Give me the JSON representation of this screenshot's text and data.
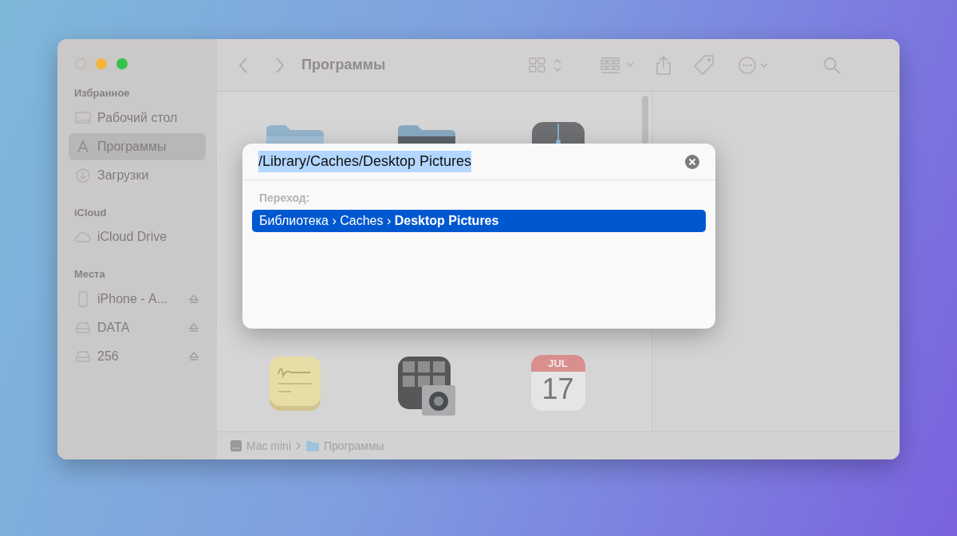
{
  "window": {
    "title": "Программы"
  },
  "sidebar": {
    "sections": [
      {
        "title": "Избранное",
        "items": [
          {
            "label": "Рабочий стол",
            "kind": "desktop",
            "selected": false,
            "ejectable": false
          },
          {
            "label": "Программы",
            "kind": "apps",
            "selected": true,
            "ejectable": false
          },
          {
            "label": "Загрузки",
            "kind": "downloads",
            "selected": false,
            "ejectable": false
          }
        ]
      },
      {
        "title": "iCloud",
        "items": [
          {
            "label": "iCloud Drive",
            "kind": "cloud",
            "selected": false,
            "ejectable": false
          }
        ]
      },
      {
        "title": "Места",
        "items": [
          {
            "label": "iPhone - А...",
            "kind": "phone",
            "selected": false,
            "ejectable": true
          },
          {
            "label": "DATA",
            "kind": "drive",
            "selected": false,
            "ejectable": true
          },
          {
            "label": "256",
            "kind": "drive",
            "selected": false,
            "ejectable": true
          }
        ]
      }
    ]
  },
  "items": [
    {
      "kind": "folder"
    },
    {
      "kind": "dark-folder"
    },
    {
      "kind": "tuner"
    },
    {
      "kind": "notes"
    },
    {
      "kind": "photo-booth"
    },
    {
      "kind": "calendar",
      "month": "JUL",
      "day": "17"
    }
  ],
  "path_bar": [
    {
      "label": "Mac mini",
      "kind": "computer"
    },
    {
      "label": "Программы",
      "kind": "folder"
    }
  ],
  "goto_dialog": {
    "value": "/Library/Caches/Desktop Pictures",
    "text_selected": true,
    "section_label": "Переход:",
    "suggestions": [
      {
        "text": "Библиотека › Caches › **Desktop Pictures**",
        "selected": true
      }
    ]
  }
}
